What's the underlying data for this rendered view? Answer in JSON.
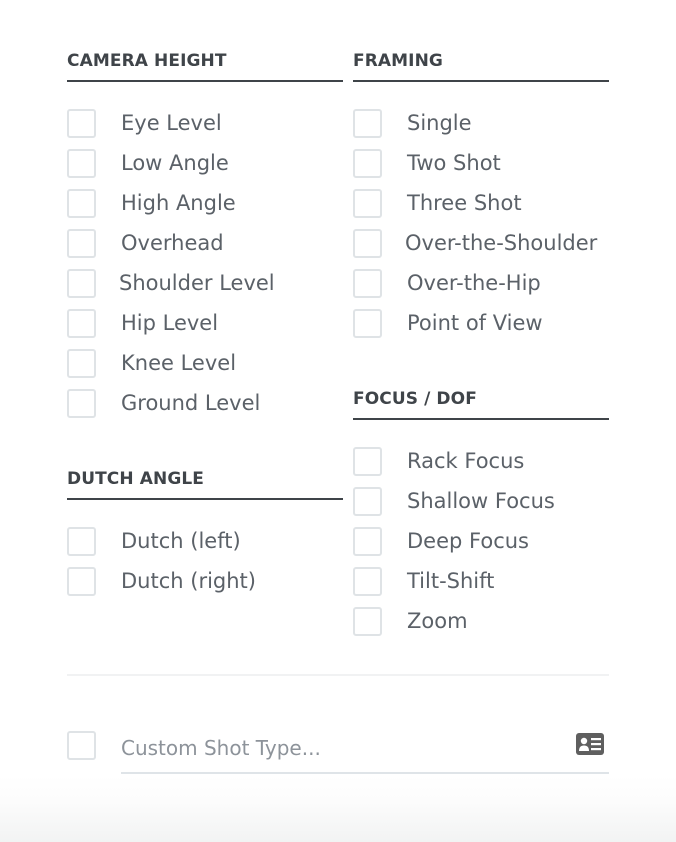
{
  "sections": {
    "camera_height": {
      "title": "CAMERA HEIGHT",
      "items": [
        {
          "label": "Eye Level",
          "checked": false
        },
        {
          "label": "Low Angle",
          "checked": false
        },
        {
          "label": "High Angle",
          "checked": false
        },
        {
          "label": "Overhead",
          "checked": false
        },
        {
          "label": "Shoulder Level",
          "checked": false
        },
        {
          "label": "Hip Level",
          "checked": false
        },
        {
          "label": "Knee Level",
          "checked": false
        },
        {
          "label": "Ground Level",
          "checked": false
        }
      ]
    },
    "framing": {
      "title": "FRAMING",
      "items": [
        {
          "label": "Single",
          "checked": false
        },
        {
          "label": "Two Shot",
          "checked": false
        },
        {
          "label": "Three Shot",
          "checked": false
        },
        {
          "label": "Over-the-Shoulder",
          "checked": false
        },
        {
          "label": "Over-the-Hip",
          "checked": false
        },
        {
          "label": "Point of View",
          "checked": false
        }
      ]
    },
    "dutch_angle": {
      "title": "DUTCH ANGLE",
      "items": [
        {
          "label": "Dutch (left)",
          "checked": false
        },
        {
          "label": "Dutch (right)",
          "checked": false
        }
      ]
    },
    "focus_dof": {
      "title": "FOCUS / DOF",
      "items": [
        {
          "label": "Rack Focus",
          "checked": false
        },
        {
          "label": "Shallow Focus",
          "checked": false
        },
        {
          "label": "Deep Focus",
          "checked": false
        },
        {
          "label": "Tilt-Shift",
          "checked": false
        },
        {
          "label": "Zoom",
          "checked": false
        }
      ]
    }
  },
  "custom": {
    "checked": false,
    "value": "",
    "placeholder": "Custom Shot Type...",
    "icon": "id-card-icon"
  },
  "colors": {
    "heading": "#3f4449",
    "label": "#5b6168",
    "checkbox_border": "#dfe3e6",
    "placeholder": "#8d939a",
    "icon": "#5f5f5f"
  }
}
